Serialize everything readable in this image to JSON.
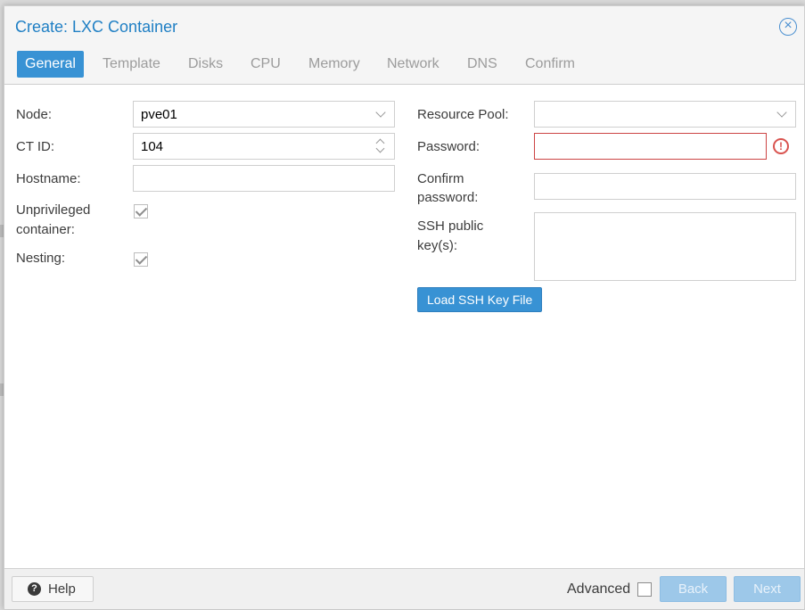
{
  "dialog": {
    "title": "Create: LXC Container",
    "close_icon": "close-circle-icon"
  },
  "tabs": [
    {
      "label": "General",
      "active": true
    },
    {
      "label": "Template",
      "active": false
    },
    {
      "label": "Disks",
      "active": false
    },
    {
      "label": "CPU",
      "active": false
    },
    {
      "label": "Memory",
      "active": false
    },
    {
      "label": "Network",
      "active": false
    },
    {
      "label": "DNS",
      "active": false
    },
    {
      "label": "Confirm",
      "active": false
    }
  ],
  "left": {
    "node": {
      "label": "Node:",
      "value": "pve01"
    },
    "ctid": {
      "label": "CT ID:",
      "value": "104"
    },
    "hostname": {
      "label": "Hostname:",
      "value": ""
    },
    "unprivileged": {
      "label_line1": "Unprivileged",
      "label_line2": "container:",
      "checked": true
    },
    "nesting": {
      "label": "Nesting:",
      "checked": true
    }
  },
  "right": {
    "pool": {
      "label": "Resource Pool:",
      "value": ""
    },
    "password": {
      "label": "Password:",
      "value": ""
    },
    "confirm": {
      "label_line1": "Confirm",
      "label_line2": "password:",
      "value": ""
    },
    "ssh": {
      "label_line1": "SSH public",
      "label_line2": "key(s):",
      "value": ""
    },
    "load_button": "Load SSH Key File"
  },
  "footer": {
    "help": "Help",
    "advanced": "Advanced",
    "back": "Back",
    "next": "Next"
  },
  "colors": {
    "accent": "#3892d4",
    "title": "#1f7fc4",
    "error": "#d9534f"
  }
}
